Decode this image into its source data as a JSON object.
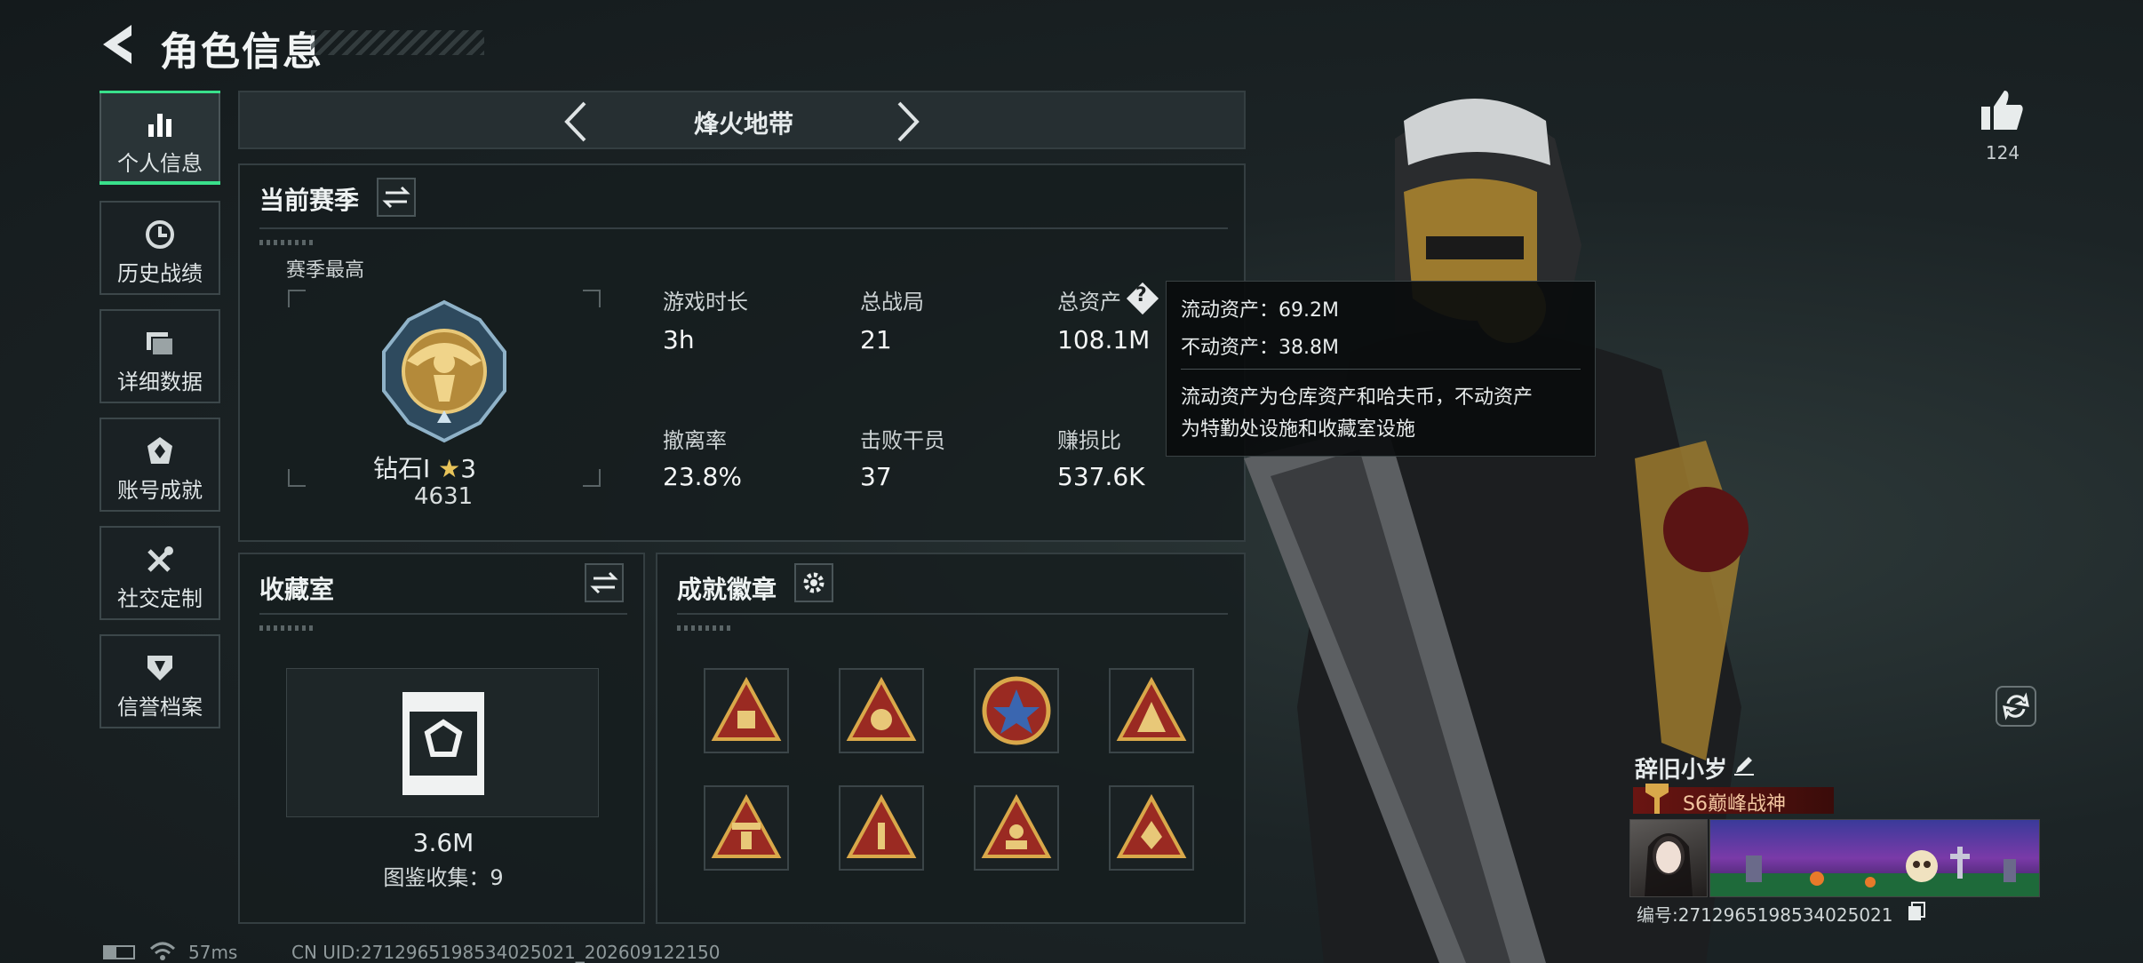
{
  "header": {
    "title": "角色信息"
  },
  "sidebar": {
    "items": [
      {
        "label": "个人信息",
        "icon": "bar-chart-icon"
      },
      {
        "label": "历史战绩",
        "icon": "history-icon"
      },
      {
        "label": "详细数据",
        "icon": "folder-icon"
      },
      {
        "label": "账号成就",
        "icon": "achievement-icon"
      },
      {
        "label": "社交定制",
        "icon": "tools-icon"
      },
      {
        "label": "信誉档案",
        "icon": "shield-icon"
      }
    ]
  },
  "mode_selector": {
    "label": "烽火地带"
  },
  "season": {
    "title": "当前赛季",
    "best_label": "赛季最高",
    "rank_name": "钻石Ⅰ",
    "rank_stars": "3",
    "rank_score": "4631",
    "stats": [
      {
        "label": "游戏时长",
        "value": "3h"
      },
      {
        "label": "总战局",
        "value": "21"
      },
      {
        "label": "总资产",
        "value": "108.1M"
      },
      {
        "label": "撤离率",
        "value": "23.8%"
      },
      {
        "label": "击败干员",
        "value": "37"
      },
      {
        "label": "赚损比",
        "value": "537.6K"
      }
    ]
  },
  "tooltip": {
    "liquid": "流动资产：69.2M",
    "fixed": "不动资产：38.8M",
    "desc1": "流动资产为仓库资产和哈夫币，不动资产",
    "desc2": "为特勤处设施和收藏室设施"
  },
  "collection": {
    "title": "收藏室",
    "value": "3.6M",
    "count_label": "图鉴收集：9"
  },
  "achievements": {
    "title": "成就徽章",
    "count": 8
  },
  "profile": {
    "likes": "124",
    "name": "辞旧小岁",
    "title_badge": "S6巅峰战神",
    "id_label": "编号:2712965198534025021"
  },
  "status_bar": {
    "ping": "57ms",
    "uid": "CN UID:2712965198534025021_202609122150"
  },
  "colors": {
    "accent": "#39e08b",
    "gold": "#c8a24a",
    "badge_red": "#8a1f1c"
  }
}
